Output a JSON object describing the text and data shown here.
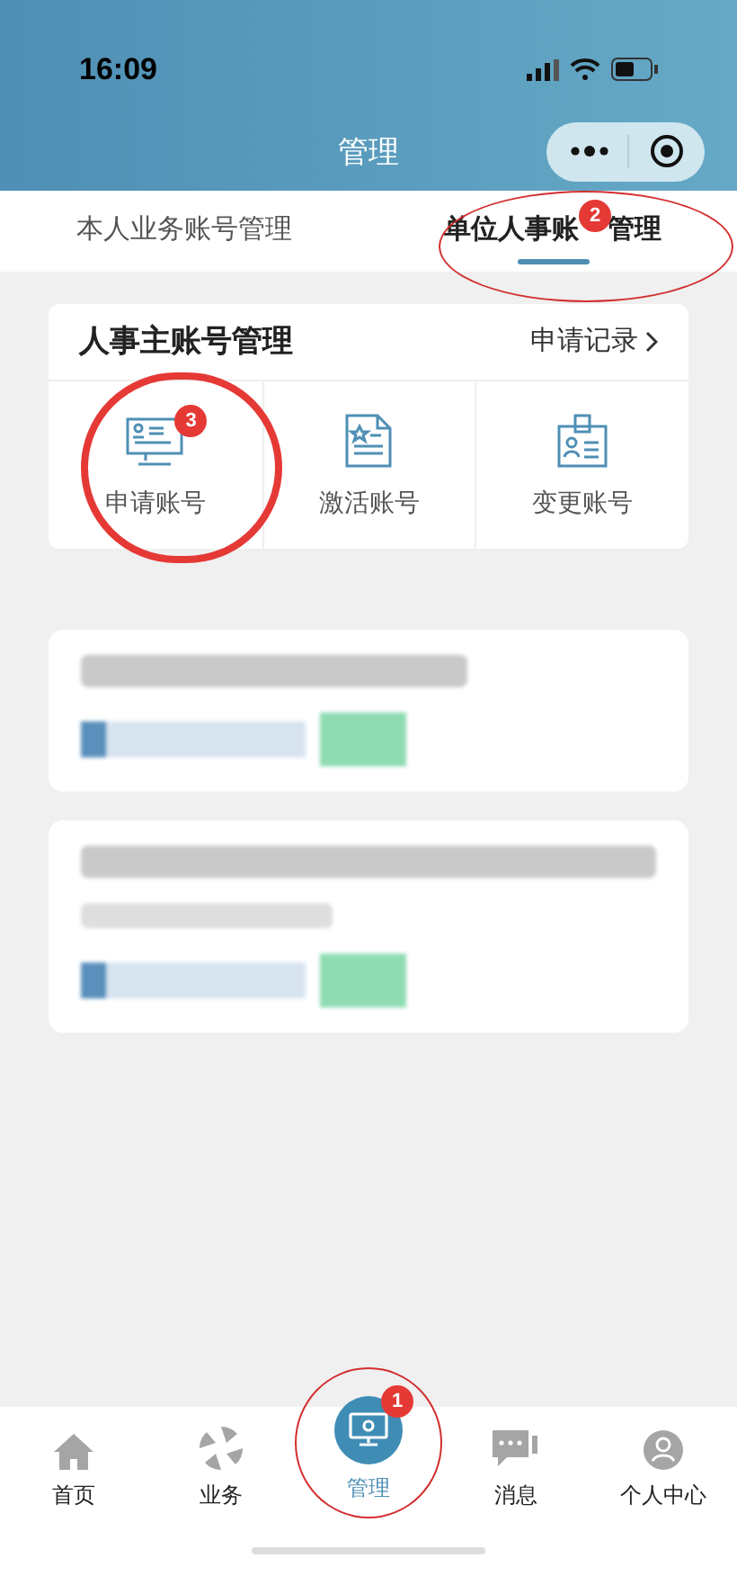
{
  "status_bar": {
    "time": "16:09"
  },
  "header": {
    "title": "管理"
  },
  "tabs": [
    {
      "label": "本人业务账号管理",
      "selected": false
    },
    {
      "label": "单位人事账",
      "label_after_annotation": "管理",
      "selected": true,
      "annotation": "2"
    }
  ],
  "section": {
    "title": "人事主账号管理",
    "link": "申请记录",
    "actions": [
      {
        "label": "申请账号",
        "kind": "monitor",
        "annotation": "3"
      },
      {
        "label": "激活账号",
        "kind": "document"
      },
      {
        "label": "变更账号",
        "kind": "badge"
      }
    ]
  },
  "blurred_cards": [
    {
      "extra_line": false
    },
    {
      "extra_line": true
    }
  ],
  "tab_bar": [
    {
      "label": "首页",
      "kind": "home",
      "selected": false
    },
    {
      "label": "业务",
      "kind": "business",
      "selected": false
    },
    {
      "label": "管理",
      "kind": "manage",
      "selected": true,
      "annotation": "1"
    },
    {
      "label": "消息",
      "kind": "message",
      "selected": false
    },
    {
      "label": "个人中心",
      "kind": "person",
      "selected": false
    }
  ]
}
